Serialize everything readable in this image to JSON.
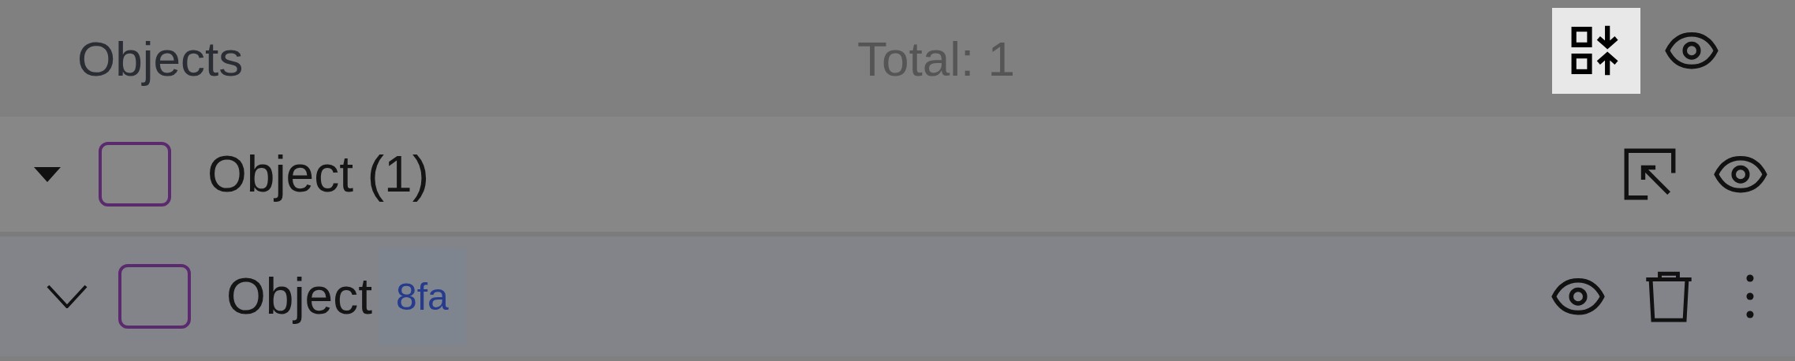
{
  "header": {
    "title": "Objects",
    "total": "Total: 1"
  },
  "groups": [
    {
      "label": "Object (1)",
      "expanded": true,
      "checked": false,
      "items": [
        {
          "name": "Object",
          "id": "8fa",
          "expanded": false,
          "checked": false
        }
      ]
    }
  ]
}
